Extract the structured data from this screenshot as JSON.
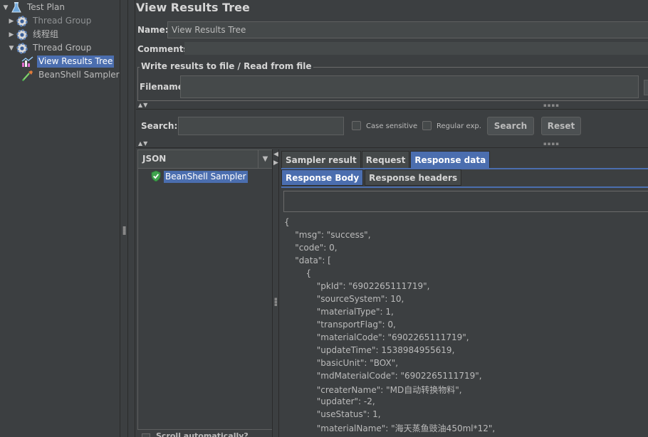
{
  "tree": {
    "items": [
      {
        "label": "Test Plan",
        "arrow": "▼",
        "icon": "flask-icon",
        "state": "normal"
      },
      {
        "label": "Thread Group",
        "arrow": "▶",
        "icon": "gear-icon",
        "state": "dim"
      },
      {
        "label": "线程组",
        "arrow": "▶",
        "icon": "gear-icon",
        "state": "normal"
      },
      {
        "label": "Thread Group",
        "arrow": "▼",
        "icon": "gear-icon",
        "state": "normal"
      },
      {
        "label": "View Results Tree",
        "arrow": "",
        "icon": "chart-icon",
        "state": "selected"
      },
      {
        "label": "BeanShell Sampler",
        "arrow": "",
        "icon": "pipette-icon",
        "state": "normal"
      }
    ]
  },
  "panel": {
    "title": "View Results Tree",
    "name_label": "Name:",
    "name_value": "View Results Tree",
    "comments_label": "Comments:"
  },
  "file_section": {
    "legend": "Write results to file / Read from file",
    "filename_label": "Filename"
  },
  "search": {
    "label": "Search:",
    "case_sensitive": "Case sensitive",
    "regular_exp": "Regular exp.",
    "search_button": "Search",
    "reset_button": "Reset"
  },
  "results": {
    "renderer": "JSON",
    "item_label": "BeanShell Sampler",
    "scroll_label": "Scroll automatically?"
  },
  "tabs": {
    "main": [
      "Sampler result",
      "Request",
      "Response data"
    ],
    "active_main": "Response data",
    "sub": [
      "Response Body",
      "Response headers"
    ],
    "active_sub": "Response Body"
  },
  "response_body": [
    "{",
    "    \"msg\": \"success\",",
    "    \"code\": 0,",
    "    \"data\": [",
    "        {",
    "            \"pkId\": \"6902265111719\",",
    "            \"sourceSystem\": 10,",
    "            \"materialType\": 1,",
    "            \"transportFlag\": 0,",
    "            \"materialCode\": \"6902265111719\",",
    "            \"updateTime\": 1538984955619,",
    "            \"basicUnit\": \"BOX\",",
    "            \"mdMaterialCode\": \"6902265111719\",",
    "            \"createrName\": \"MD自动转换物料\",",
    "            \"updater\": -2,",
    "            \"useStatus\": 1,",
    "            \"materialName\": \"海天蒸鱼豉油450ml*12\","
  ],
  "colors": {
    "background": "#3c3f41",
    "selection": "#4b6eaf",
    "text": "#bbbbbb",
    "success_shield": "#3fa34d"
  }
}
